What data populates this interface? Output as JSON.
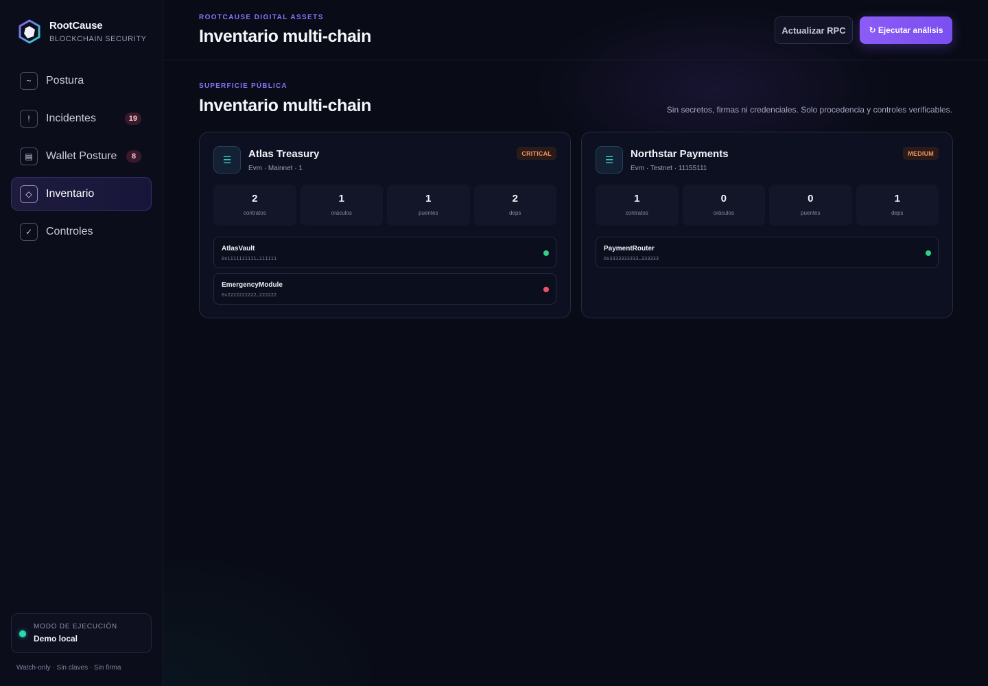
{
  "brand": {
    "name": "RootCause",
    "subtitle": "BLOCKCHAIN SECURITY"
  },
  "sidebar": {
    "items": [
      {
        "label": "Postura",
        "icon": "pulse-icon",
        "glyph": "~",
        "badge": null,
        "active": false
      },
      {
        "label": "Incidentes",
        "icon": "alert-icon",
        "glyph": "!",
        "badge": "19",
        "active": false
      },
      {
        "label": "Wallet Posture",
        "icon": "wallet-icon",
        "glyph": "▤",
        "badge": "8",
        "active": false
      },
      {
        "label": "Inventario",
        "icon": "inventory-icon",
        "glyph": "◇",
        "badge": null,
        "active": true
      },
      {
        "label": "Controles",
        "icon": "check-icon",
        "glyph": "✓",
        "badge": null,
        "active": false
      }
    ],
    "mode": {
      "label": "MODO DE EJECUCIÓN",
      "value": "Demo local"
    },
    "footer": "Watch-only · Sin claves · Sin firma"
  },
  "header": {
    "eyebrow": "ROOTCAUSE DIGITAL ASSETS",
    "title": "Inventario multi-chain",
    "refresh_label": "Actualizar RPC",
    "run_label": "↻ Ejecutar análisis"
  },
  "section": {
    "eyebrow": "SUPERFICIE PÚBLICA",
    "title": "Inventario multi-chain",
    "note": "Sin secretos, firmas ni credenciales. Solo procedencia y controles verificables."
  },
  "cards": [
    {
      "name": "Atlas Treasury",
      "meta": "Evm · Mainnet · 1",
      "severity": "CRITICAL",
      "icon": "chain-icon",
      "stats": [
        {
          "value": "2",
          "label": "contratos"
        },
        {
          "value": "1",
          "label": "oráculos"
        },
        {
          "value": "1",
          "label": "puentes"
        },
        {
          "value": "2",
          "label": "deps"
        }
      ],
      "contracts": [
        {
          "name": "AtlasVault",
          "address": "0x1111111111…111111",
          "status": "ok"
        },
        {
          "name": "EmergencyModule",
          "address": "0x2222222222…222222",
          "status": "alert"
        }
      ]
    },
    {
      "name": "Northstar Payments",
      "meta": "Evm · Testnet · 11155111",
      "severity": "MEDIUM",
      "icon": "chain-icon",
      "stats": [
        {
          "value": "1",
          "label": "contratos"
        },
        {
          "value": "0",
          "label": "oráculos"
        },
        {
          "value": "0",
          "label": "puentes"
        },
        {
          "value": "1",
          "label": "deps"
        }
      ],
      "contracts": [
        {
          "name": "PaymentRouter",
          "address": "0x3333333333…333333",
          "status": "ok"
        }
      ]
    }
  ],
  "colors": {
    "accent": "#8b5cf6",
    "status_ok": "#2fd18a",
    "status_alert": "#f0506e",
    "severity_text": "#f2915a"
  }
}
